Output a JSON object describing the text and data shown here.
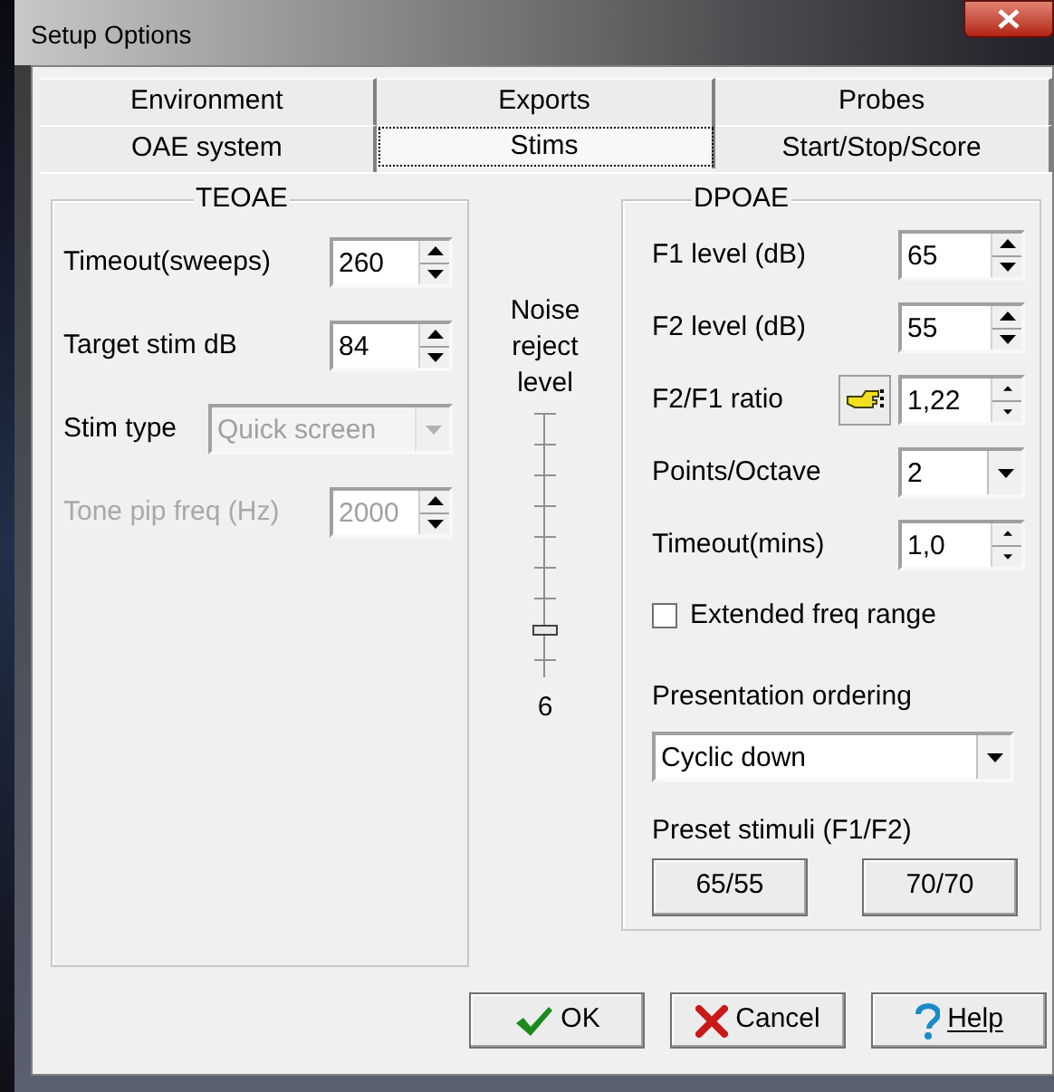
{
  "window": {
    "title": "Setup Options"
  },
  "tab_rows": [
    {
      "tabs": [
        {
          "label": "Environment",
          "selected": false
        },
        {
          "label": "Exports",
          "selected": false
        },
        {
          "label": "Probes",
          "selected": false
        }
      ]
    },
    {
      "tabs": [
        {
          "label": "OAE system",
          "selected": false
        },
        {
          "label": "Stims",
          "selected": true
        },
        {
          "label": "Start/Stop/Score",
          "selected": false
        }
      ]
    }
  ],
  "teoae": {
    "title": "TEOAE",
    "fields": [
      {
        "label": "Timeout(sweeps)",
        "value": "260",
        "kind": "spin",
        "disabled": false,
        "label_disabled": false
      },
      {
        "label": "Target stim dB",
        "value": "84",
        "kind": "spin",
        "disabled": false,
        "label_disabled": false
      },
      {
        "label": "Stim type",
        "value": "Quick screen",
        "kind": "combo",
        "disabled": true,
        "label_disabled": false
      },
      {
        "label": "Tone pip freq (Hz)",
        "value": "2000",
        "kind": "spin",
        "disabled": true,
        "label_disabled": true
      }
    ]
  },
  "noise_reject": {
    "label": "Noise reject level",
    "level": 0.12,
    "reading": "6"
  },
  "dpoae": {
    "title": "DPOAE",
    "fields": [
      {
        "label": "F1 level (dB)",
        "value": "65",
        "kind": "spin"
      },
      {
        "label": "F2 level (dB)",
        "value": "55",
        "kind": "spin"
      },
      {
        "label": "F2/F1 ratio",
        "value": "1,22",
        "kind": "picker_spin"
      },
      {
        "label": "Points/Octave",
        "value": "2",
        "kind": "combo"
      },
      {
        "label": "Timeout(mins)",
        "value": "1,0",
        "kind": "small_spin"
      }
    ],
    "checkbox": {
      "label": "Extended freq range",
      "checked": false
    },
    "ordering": {
      "label": "Presentation ordering",
      "value": "Cyclic down"
    },
    "preset": {
      "label": "Preset stimuli (F1/F2)",
      "buttons": [
        "65/55",
        "70/70"
      ]
    }
  },
  "buttons": [
    {
      "label": "OK",
      "kind": "ok",
      "mnemonic": false
    },
    {
      "label": "Cancel",
      "kind": "cancel",
      "mnemonic": false
    },
    {
      "label": "Help",
      "kind": "help",
      "mnemonic": true
    }
  ]
}
